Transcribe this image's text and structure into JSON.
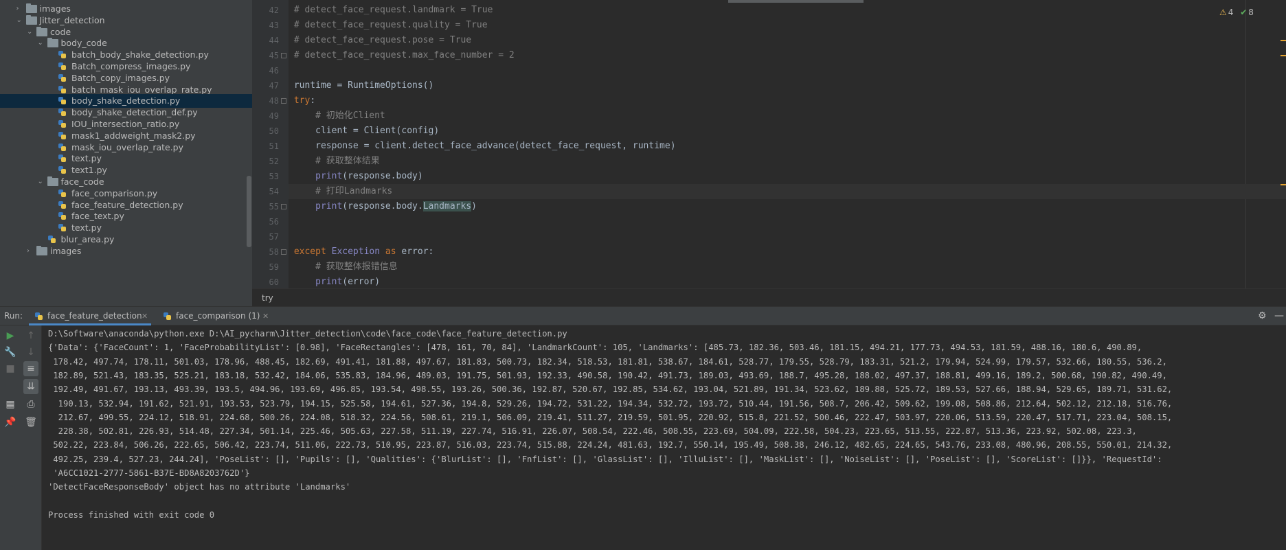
{
  "project_tree": [
    {
      "label": "images",
      "type": "folder",
      "depth": 1,
      "expanded": false
    },
    {
      "label": "Jitter_detection",
      "type": "folder",
      "depth": 1,
      "expanded": true
    },
    {
      "label": "code",
      "type": "folder",
      "depth": 2,
      "expanded": true
    },
    {
      "label": "body_code",
      "type": "folder",
      "depth": 3,
      "expanded": true
    },
    {
      "label": "batch_body_shake_detection.py",
      "type": "file",
      "depth": 4
    },
    {
      "label": "Batch_compress_images.py",
      "type": "file",
      "depth": 4
    },
    {
      "label": "Batch_copy_images.py",
      "type": "file",
      "depth": 4
    },
    {
      "label": "batch_mask_iou_overlap_rate.py",
      "type": "file",
      "depth": 4
    },
    {
      "label": "body_shake_detection.py",
      "type": "file",
      "depth": 4,
      "selected": true
    },
    {
      "label": "body_shake_detection_def.py",
      "type": "file",
      "depth": 4
    },
    {
      "label": "IOU_intersection_ratio.py",
      "type": "file",
      "depth": 4
    },
    {
      "label": "mask1_addweight_mask2.py",
      "type": "file",
      "depth": 4
    },
    {
      "label": "mask_iou_overlap_rate.py",
      "type": "file",
      "depth": 4
    },
    {
      "label": "text.py",
      "type": "file",
      "depth": 4
    },
    {
      "label": "text1.py",
      "type": "file",
      "depth": 4
    },
    {
      "label": "face_code",
      "type": "folder",
      "depth": 3,
      "expanded": true
    },
    {
      "label": "face_comparison.py",
      "type": "file",
      "depth": 4
    },
    {
      "label": "face_feature_detection.py",
      "type": "file",
      "depth": 4
    },
    {
      "label": "face_text.py",
      "type": "file",
      "depth": 4
    },
    {
      "label": "text.py",
      "type": "file",
      "depth": 4
    },
    {
      "label": "blur_area.py",
      "type": "file",
      "depth": 3
    },
    {
      "label": "images",
      "type": "folder",
      "depth": 2,
      "expanded": false
    }
  ],
  "editor": {
    "inspection": {
      "warnings": "4",
      "ok": "8"
    },
    "lines": [
      {
        "n": "42",
        "segs": [
          {
            "t": "# detect_face_request.landmark = True",
            "c": "com"
          }
        ]
      },
      {
        "n": "43",
        "segs": [
          {
            "t": "# detect_face_request.quality = True",
            "c": "com"
          }
        ]
      },
      {
        "n": "44",
        "segs": [
          {
            "t": "# detect_face_request.pose = True",
            "c": "com"
          }
        ]
      },
      {
        "n": "45",
        "segs": [
          {
            "t": "# detect_face_request.max_face_number = 2",
            "c": "com"
          }
        ],
        "fold": true
      },
      {
        "n": "46",
        "segs": []
      },
      {
        "n": "47",
        "segs": [
          {
            "t": "runtime = RuntimeOptions()",
            "c": ""
          }
        ]
      },
      {
        "n": "48",
        "segs": [
          {
            "t": "try",
            "c": "kw"
          },
          {
            "t": ":",
            "c": ""
          }
        ],
        "fold": true
      },
      {
        "n": "49",
        "segs": [
          {
            "t": "    # 初始化Client",
            "c": "com"
          }
        ]
      },
      {
        "n": "50",
        "segs": [
          {
            "t": "    client = Client(config)",
            "c": ""
          }
        ]
      },
      {
        "n": "51",
        "segs": [
          {
            "t": "    response = client.detect_face_advance(detect_face_request, runtime)",
            "c": ""
          }
        ]
      },
      {
        "n": "52",
        "segs": [
          {
            "t": "    # 获取整体结果",
            "c": "com"
          }
        ]
      },
      {
        "n": "53",
        "segs": [
          {
            "t": "    ",
            "c": ""
          },
          {
            "t": "print",
            "c": "cls"
          },
          {
            "t": "(response.body)",
            "c": ""
          }
        ]
      },
      {
        "n": "54",
        "segs": [
          {
            "t": "    # 打印Landmarks",
            "c": "com"
          }
        ],
        "current": true
      },
      {
        "n": "55",
        "segs": [
          {
            "t": "    ",
            "c": ""
          },
          {
            "t": "print",
            "c": "cls"
          },
          {
            "t": "(response.body.",
            "c": ""
          },
          {
            "t": "Landmarks",
            "c": "sel"
          },
          {
            "t": ")",
            "c": ""
          }
        ],
        "fold": true
      },
      {
        "n": "56",
        "segs": []
      },
      {
        "n": "57",
        "segs": []
      },
      {
        "n": "58",
        "segs": [
          {
            "t": "except ",
            "c": "kw"
          },
          {
            "t": "Exception",
            "c": "cls"
          },
          {
            "t": " as ",
            "c": "kw"
          },
          {
            "t": "error:",
            "c": ""
          }
        ],
        "fold": true
      },
      {
        "n": "59",
        "segs": [
          {
            "t": "    # 获取整体报错信息",
            "c": "com"
          }
        ]
      },
      {
        "n": "60",
        "segs": [
          {
            "t": "    ",
            "c": ""
          },
          {
            "t": "print",
            "c": "cls"
          },
          {
            "t": "(error)",
            "c": ""
          }
        ]
      }
    ],
    "breadcrumb": "try"
  },
  "run": {
    "label": "Run:",
    "tabs": [
      {
        "label": "face_feature_detection",
        "active": true
      },
      {
        "label": "face_comparison (1)",
        "active": false
      }
    ],
    "console": [
      "D:\\Software\\anaconda\\python.exe D:\\AI_pycharm\\Jitter_detection\\code\\face_code\\face_feature_detection.py",
      "{'Data': {'FaceCount': 1, 'FaceProbabilityList': [0.98], 'FaceRectangles': [478, 161, 70, 84], 'LandmarkCount': 105, 'Landmarks': [485.73, 182.36, 503.46, 181.15, 494.21, 177.73, 494.53, 181.59, 488.16, 180.6, 490.89,",
      " 178.42, 497.74, 178.11, 501.03, 178.96, 488.45, 182.69, 491.41, 181.88, 497.67, 181.83, 500.73, 182.34, 518.53, 181.81, 538.67, 184.61, 528.77, 179.55, 528.79, 183.31, 521.2, 179.94, 524.99, 179.57, 532.66, 180.55, 536.2,",
      " 182.89, 521.43, 183.35, 525.21, 183.18, 532.42, 184.06, 535.83, 184.96, 489.03, 191.75, 501.93, 192.33, 490.58, 190.42, 491.73, 189.03, 493.69, 188.7, 495.28, 188.02, 497.37, 188.81, 499.16, 189.2, 500.68, 190.82, 490.49,",
      " 192.49, 491.67, 193.13, 493.39, 193.5, 494.96, 193.69, 496.85, 193.54, 498.55, 193.26, 500.36, 192.87, 520.67, 192.85, 534.62, 193.04, 521.89, 191.34, 523.62, 189.88, 525.72, 189.53, 527.66, 188.94, 529.65, 189.71, 531.62,",
      "  190.13, 532.94, 191.62, 521.91, 193.53, 523.79, 194.15, 525.58, 194.61, 527.36, 194.8, 529.26, 194.72, 531.22, 194.34, 532.72, 193.72, 510.44, 191.56, 508.7, 206.42, 509.62, 199.08, 508.86, 212.64, 502.12, 212.18, 516.76,",
      "  212.67, 499.55, 224.12, 518.91, 224.68, 500.26, 224.08, 518.32, 224.56, 508.61, 219.1, 506.09, 219.41, 511.27, 219.59, 501.95, 220.92, 515.8, 221.52, 500.46, 222.47, 503.97, 220.06, 513.59, 220.47, 517.71, 223.04, 508.15,",
      "  228.38, 502.81, 226.93, 514.48, 227.34, 501.14, 225.46, 505.63, 227.58, 511.19, 227.74, 516.91, 226.07, 508.54, 222.46, 508.55, 223.69, 504.09, 222.58, 504.23, 223.65, 513.55, 222.87, 513.36, 223.92, 502.08, 223.3,",
      " 502.22, 223.84, 506.26, 222.65, 506.42, 223.74, 511.06, 222.73, 510.95, 223.87, 516.03, 223.74, 515.88, 224.24, 481.63, 192.7, 550.14, 195.49, 508.38, 246.12, 482.65, 224.65, 543.76, 233.08, 480.96, 208.55, 550.01, 214.32,",
      " 492.25, 239.4, 527.23, 244.24], 'PoseList': [], 'Pupils': [], 'Qualities': {'BlurList': [], 'FnfList': [], 'GlassList': [], 'IlluList': [], 'MaskList': [], 'NoiseList': [], 'PoseList': [], 'ScoreList': []}}, 'RequestId':",
      " 'A6CC1021-2777-5861-B37E-BD8A8203762D'}",
      "'DetectFaceResponseBody' object has no attribute 'Landmarks'",
      "",
      "Process finished with exit code 0"
    ]
  },
  "colors": {
    "accent": "#4a88c7",
    "warning": "#e6b450",
    "ok": "#5fb15f",
    "run_green": "#499c54"
  }
}
